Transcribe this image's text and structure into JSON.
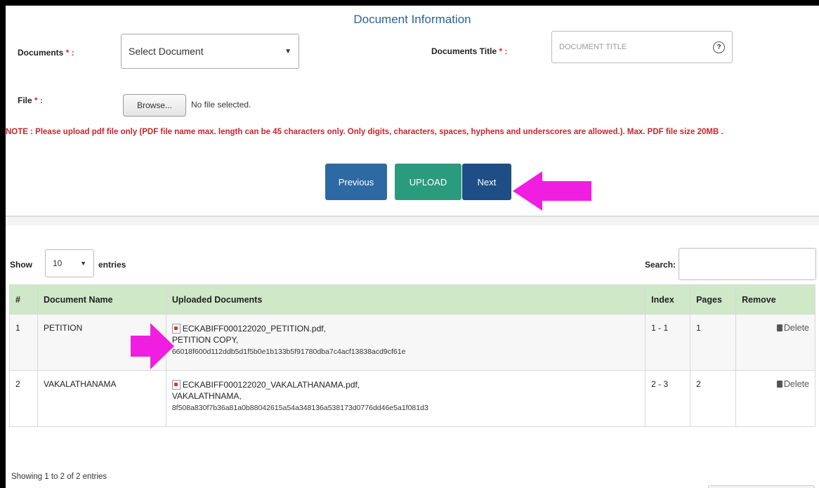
{
  "form": {
    "title": "Document Information",
    "documents_label": "Documents",
    "documents_title_label": "Documents Title",
    "file_label": "File",
    "required_marker": "* :",
    "file_required_marker": "* :",
    "document_select_value": "Select Document",
    "document_title_placeholder": "DOCUMENT TITLE",
    "browse_label": "Browse...",
    "file_status": "No file selected.",
    "note": "NOTE : Please upload pdf file only (PDF file name max. length can be 45 characters only. Only digits, characters, spaces, hyphens and underscores are allowed.). Max. PDF file size 20MB .",
    "previous_label": "Previous",
    "upload_label": "UPLOAD",
    "next_label": "Next"
  },
  "table_controls": {
    "show_label": "Show",
    "page_length": "10",
    "entries_label": "entries",
    "search_label": "Search:"
  },
  "table": {
    "headers": [
      "#",
      "Document Name",
      "Uploaded Documents",
      "Index",
      "Pages",
      "Remove"
    ],
    "rows": [
      {
        "num": "1",
        "name": "PETITION",
        "file": "ECKABIFF000122020_PETITION.pdf,",
        "desc": "PETITION COPY,",
        "hash": "66018f600d112ddb5d1f5b0e1b133b5f91780dba7c4acf13838acd9cf61e",
        "index": "1 - 1",
        "pages": "1",
        "remove": "Delete"
      },
      {
        "num": "2",
        "name": "VAKALATHANAMA",
        "file": "ECKABIFF000122020_VAKALATHANAMA.pdf,",
        "desc": "VAKALATHNAMA,",
        "hash": "8f508a830f7b36a81a0b88042615a54a348136a538173d0776dd46e5a1f081d3",
        "index": "2 - 3",
        "pages": "2",
        "remove": "Delete"
      }
    ]
  },
  "footer": {
    "showing": "Showing 1 to 2 of 2 entries"
  },
  "colors": {
    "title": "#2a6496",
    "note": "#c9252c",
    "previous_button": "#2d6aa3",
    "upload_button": "#2a9c7d",
    "next_button": "#1d4f86",
    "table_header": "#cfe8c8",
    "annotation_arrow": "#f01ee0"
  }
}
